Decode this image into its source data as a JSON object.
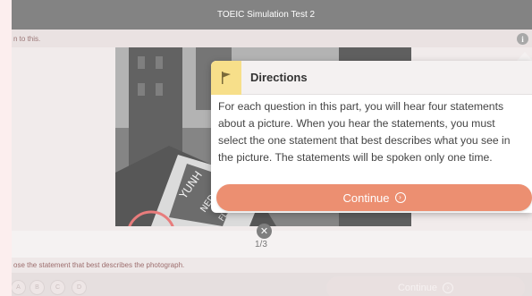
{
  "app": {
    "title": "TOEIC Simulation Test 2",
    "subbar_text": "n to this.",
    "pager": "1/3",
    "instruction": "ose the statement that best describes the photograph.",
    "options": [
      "A",
      "B",
      "C",
      "D"
    ],
    "continue_label": "Continue"
  },
  "directions": {
    "title": "Directions",
    "body": "For each question in this part, you will hear four statements about a picture. When you hear the statements, you must select the one statement that best describes what you see in the picture. The statements will be spoken only one time.",
    "continue_label": "Continue"
  },
  "icons": {
    "info": "info-icon",
    "flag": "flag-icon",
    "close": "close-icon",
    "arrow": "arrow-right-circle-icon"
  },
  "colors": {
    "accent": "#ec8f71",
    "flag_bg": "#f7df8a",
    "header": "#5a5a5a"
  }
}
